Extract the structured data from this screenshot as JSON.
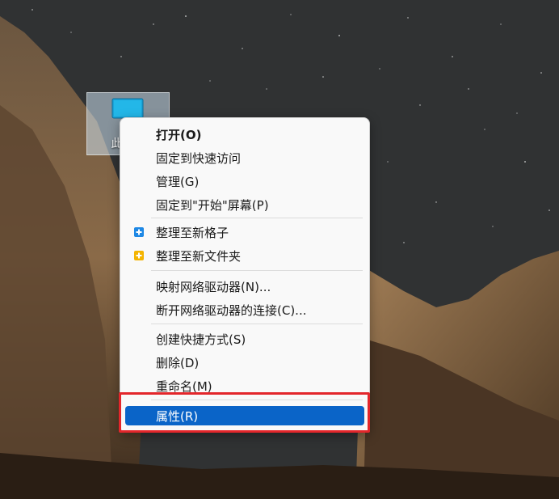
{
  "desktop": {
    "icon_label": "此电脑"
  },
  "context_menu": {
    "items": [
      {
        "label": "打开(O)",
        "bold": true
      },
      {
        "label": "固定到快速访问"
      },
      {
        "label": "管理(G)"
      },
      {
        "label": "固定到\"开始\"屏幕(P)"
      },
      {
        "label": "整理至新格子",
        "icon": "grid-plus-icon",
        "icon_color": "#1e88e5"
      },
      {
        "label": "整理至新文件夹",
        "icon": "folder-plus-icon",
        "icon_color": "#f4b400"
      },
      {
        "label": "映射网络驱动器(N)..."
      },
      {
        "label": "断开网络驱动器的连接(C)..."
      },
      {
        "label": "创建快捷方式(S)"
      },
      {
        "label": "删除(D)"
      },
      {
        "label": "重命名(M)"
      },
      {
        "label": "属性(R)",
        "highlighted": true
      }
    ]
  },
  "colors": {
    "highlight": "#0a64c8",
    "annotation_box": "#e3262b",
    "menu_bg": "#f9f9f9"
  }
}
